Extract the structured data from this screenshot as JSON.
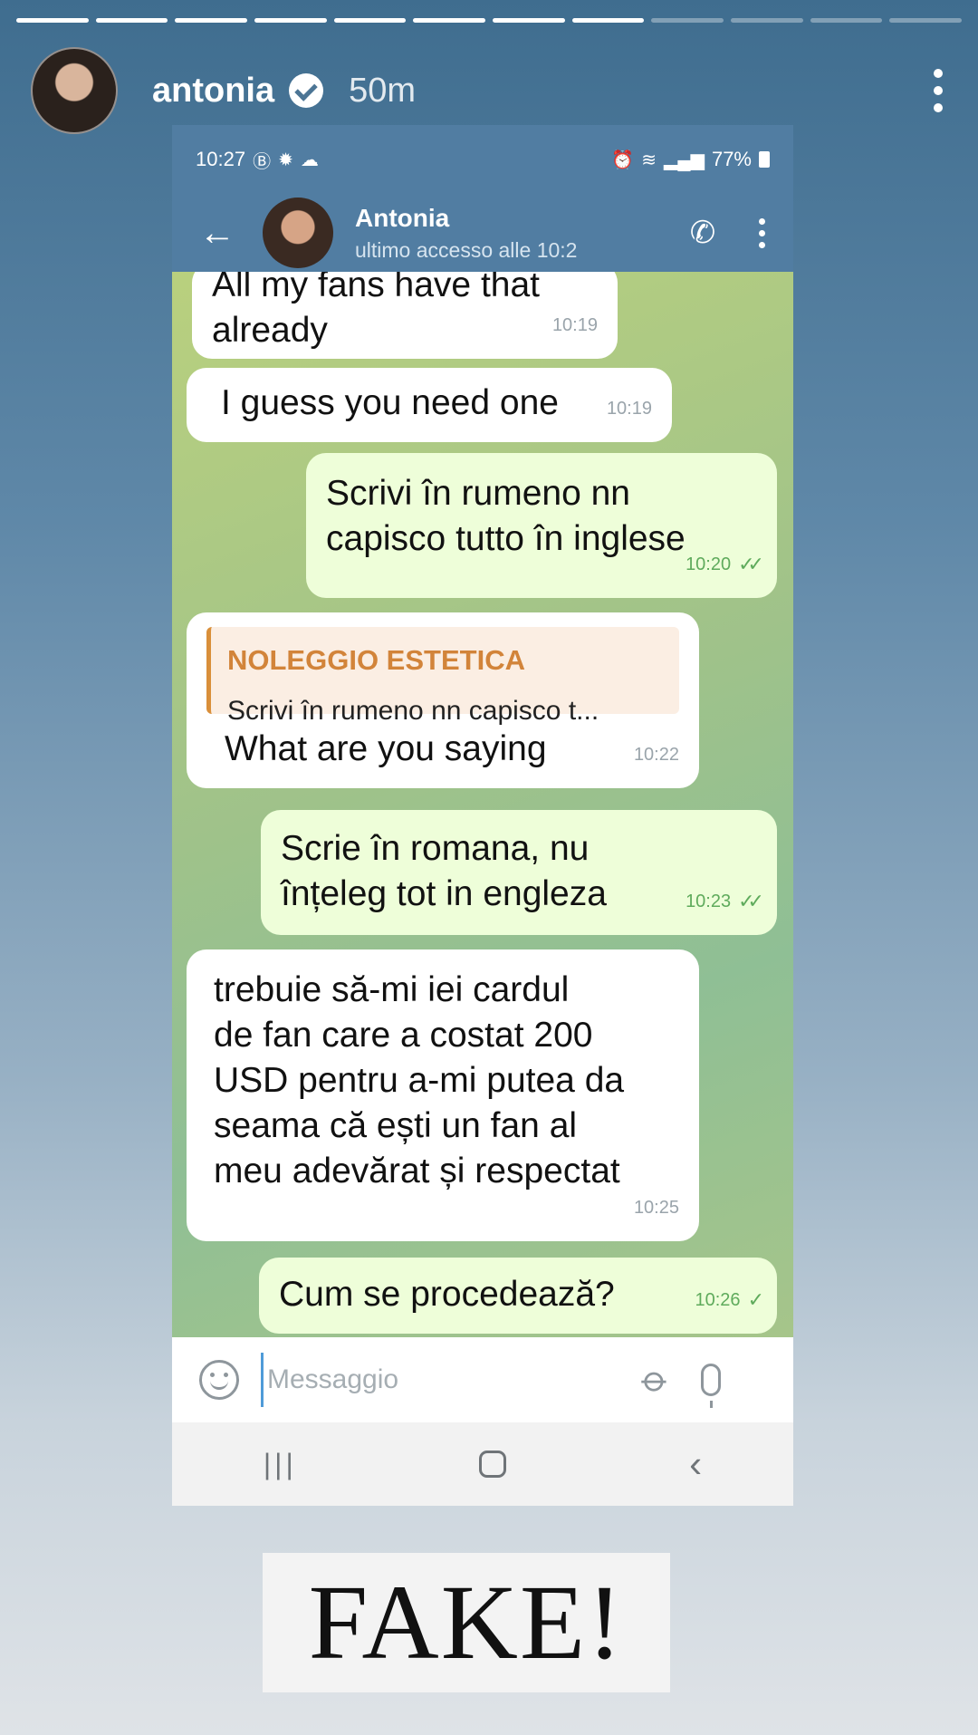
{
  "story": {
    "progress": [
      1,
      1,
      1,
      1,
      1,
      1,
      1,
      1,
      0,
      0,
      0,
      0
    ],
    "username": "antonia",
    "verified": true,
    "time": "50m"
  },
  "phone": {
    "status_bar": {
      "time": "10:27",
      "battery": "77%"
    },
    "chat_header": {
      "name": "Antonia",
      "status": "ultimo accesso alle 10:2"
    },
    "messages": [
      {
        "direction": "in",
        "text": "All my fans have that\nalready",
        "time": "10:19"
      },
      {
        "direction": "in",
        "text": "I guess you need one",
        "time": "10:19"
      },
      {
        "direction": "out",
        "text": "Scrivi în rumeno nn\ncapisco tutto în inglese",
        "time": "10:20",
        "ticks": "double"
      },
      {
        "direction": "in",
        "reply_name": "NOLEGGIO ESTETICA",
        "reply_text": "Scrivi în rumeno nn capisco t...",
        "text": "What are you saying",
        "time": "10:22"
      },
      {
        "direction": "out",
        "text": "Scrie în romana, nu\nînțeleg tot in engleza",
        "time": "10:23",
        "ticks": "double"
      },
      {
        "direction": "in",
        "text": "trebuie să-mi iei cardul\nde fan care a costat 200\nUSD pentru a-mi putea da\nseama că ești un fan al\nmeu adevărat și respectat",
        "time": "10:25"
      },
      {
        "direction": "out",
        "text": "Cum se procedează?",
        "time": "10:26",
        "ticks": "single"
      }
    ],
    "input": {
      "placeholder": "Messaggio"
    }
  },
  "overlay_text": "FAKE!",
  "colors": {
    "telegram_header": "#517da2",
    "incoming_bubble": "#ffffff",
    "outgoing_bubble": "#eefed9",
    "reply_accent": "#d98f3a"
  },
  "icons": [
    "back-arrow-icon",
    "phone-icon",
    "more-vertical-icon",
    "emoji-icon",
    "attach-icon",
    "mic-icon",
    "recent-apps-icon",
    "home-icon",
    "nav-back-icon",
    "verified-badge-icon"
  ]
}
